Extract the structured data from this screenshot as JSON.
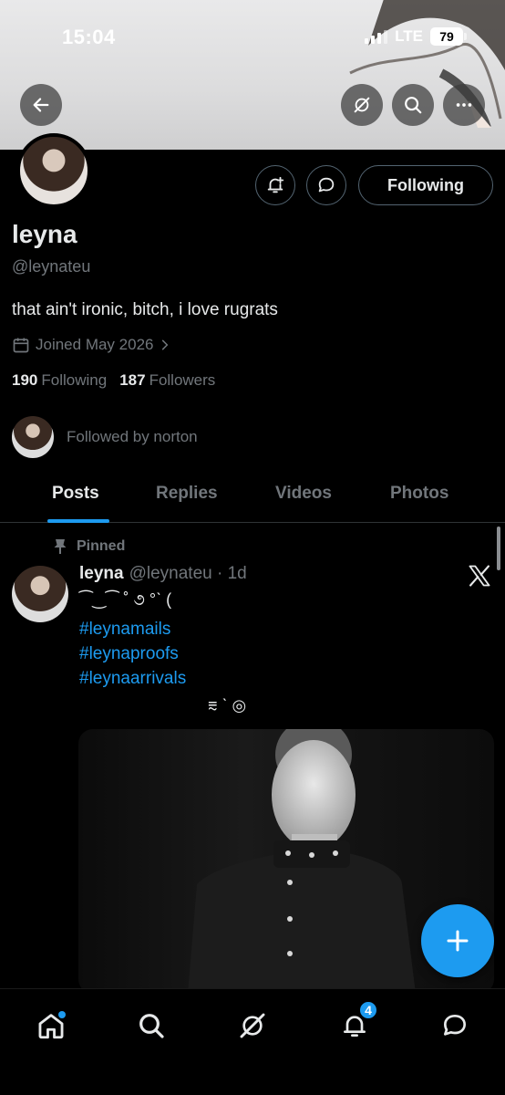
{
  "status_bar": {
    "time": "15:04",
    "network": "LTE",
    "battery": "79"
  },
  "header": {
    "back_icon": "arrow-left-icon",
    "grok_icon": "grok-icon",
    "search_icon": "search-icon",
    "more_icon": "more-icon"
  },
  "profile": {
    "name": "leyna",
    "handle": "@leynateu",
    "bio": "that ain't ironic, bitch, i love rugrats",
    "joined": "Joined May 2026",
    "following_count": "190",
    "following_label": "Following",
    "followers_count": "187",
    "followers_label": "Followers",
    "followed_by": "Followed by norton",
    "follow_button": "Following"
  },
  "tabs": [
    {
      "label": "Posts",
      "active": true
    },
    {
      "label": "Replies",
      "active": false
    },
    {
      "label": "Videos",
      "active": false
    },
    {
      "label": "Photos",
      "active": false
    }
  ],
  "post": {
    "pinned_label": "Pinned",
    "author": "leyna",
    "meta": "@leynateu · 1d",
    "line1": "⁀‿⁀ ˚ ૭ °ˋ (",
    "hashtags": [
      "#leynamails",
      "#leynaproofs",
      "#leynaarrivals"
    ],
    "line_last": "⩳ ˋ ◎"
  },
  "bottom_nav": {
    "items": [
      "home-icon",
      "search-icon",
      "grok-icon",
      "notifications-icon",
      "messages-icon"
    ],
    "notifications_badge": "4"
  },
  "colors": {
    "accent": "#1d9bf0",
    "background": "#000000",
    "muted": "#71767b",
    "text": "#e7e9ea"
  }
}
